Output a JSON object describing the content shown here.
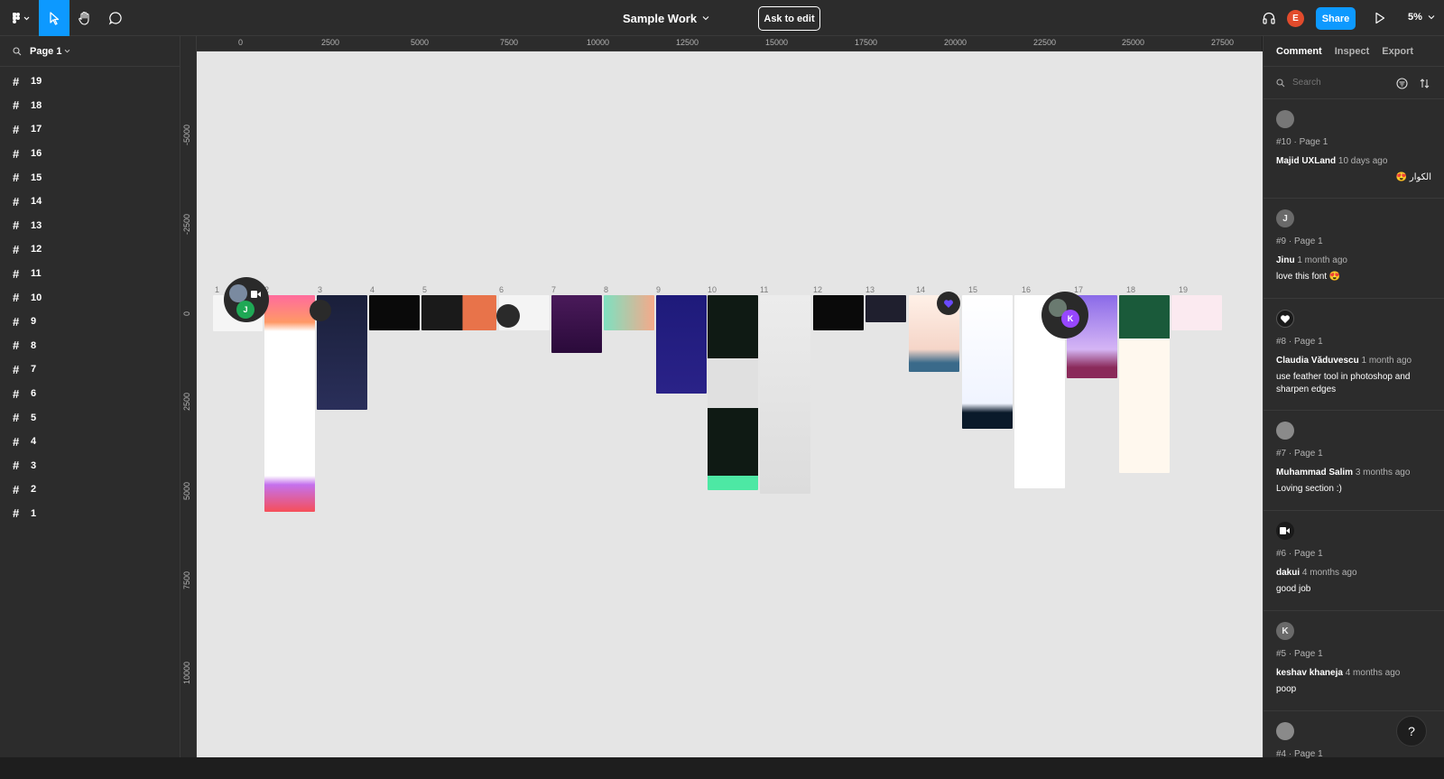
{
  "toolbar": {
    "doc_title": "Sample Work",
    "ask_to_edit": "Ask to edit",
    "user_initial": "E",
    "share": "Share",
    "zoom": "5%",
    "colors": {
      "accent": "#0d99ff",
      "avatar": "#e24b2c"
    }
  },
  "left_panel": {
    "page_label": "Page 1",
    "layers": [
      "19",
      "18",
      "17",
      "16",
      "15",
      "14",
      "13",
      "12",
      "11",
      "10",
      "9",
      "8",
      "7",
      "6",
      "5",
      "4",
      "3",
      "2",
      "1"
    ]
  },
  "ruler": {
    "top": [
      "0",
      "2500",
      "5000",
      "7500",
      "10000",
      "12500",
      "15000",
      "17500",
      "20000",
      "22500",
      "25000",
      "27500"
    ],
    "left": [
      "-5000",
      "-2500",
      "0",
      "2500",
      "5000",
      "7500",
      "10000"
    ]
  },
  "canvas": {
    "frame_labels": [
      "1",
      "2",
      "3",
      "4",
      "5",
      "6",
      "7",
      "8",
      "9",
      "10",
      "11",
      "12",
      "13",
      "14",
      "15",
      "16",
      "17",
      "18",
      "19"
    ],
    "cursor_initials": [
      "J",
      "K"
    ]
  },
  "right_panel": {
    "tabs": [
      "Comment",
      "Inspect",
      "Export"
    ],
    "search_placeholder": "Search",
    "comments": [
      {
        "initial": "",
        "id": "#10 · Page 1",
        "author": "Majid UXLand",
        "time": "10 days ago",
        "text": "😍 الکوار"
      },
      {
        "initial": "J",
        "id": "#9 · Page 1",
        "author": "Jinu",
        "time": "1 month ago",
        "text": "love this font 😍"
      },
      {
        "initial": "",
        "id": "#8 · Page 1",
        "author": "Claudia Văduvescu",
        "time": "1 month ago",
        "text": "use feather tool in photoshop and sharpen edges"
      },
      {
        "initial": "",
        "id": "#7 · Page 1",
        "author": "Muhammad Salim",
        "time": "3 months ago",
        "text": "Loving section :)"
      },
      {
        "initial": "",
        "id": "#6 · Page 1",
        "author": "dakui",
        "time": "4 months ago",
        "text": "good job"
      },
      {
        "initial": "K",
        "id": "#5 · Page 1",
        "author": "keshav khaneja",
        "time": "4 months ago",
        "text": "poop"
      },
      {
        "initial": "",
        "id": "#4 · Page 1",
        "author": "",
        "time": "",
        "text": ""
      }
    ],
    "help": "?"
  }
}
